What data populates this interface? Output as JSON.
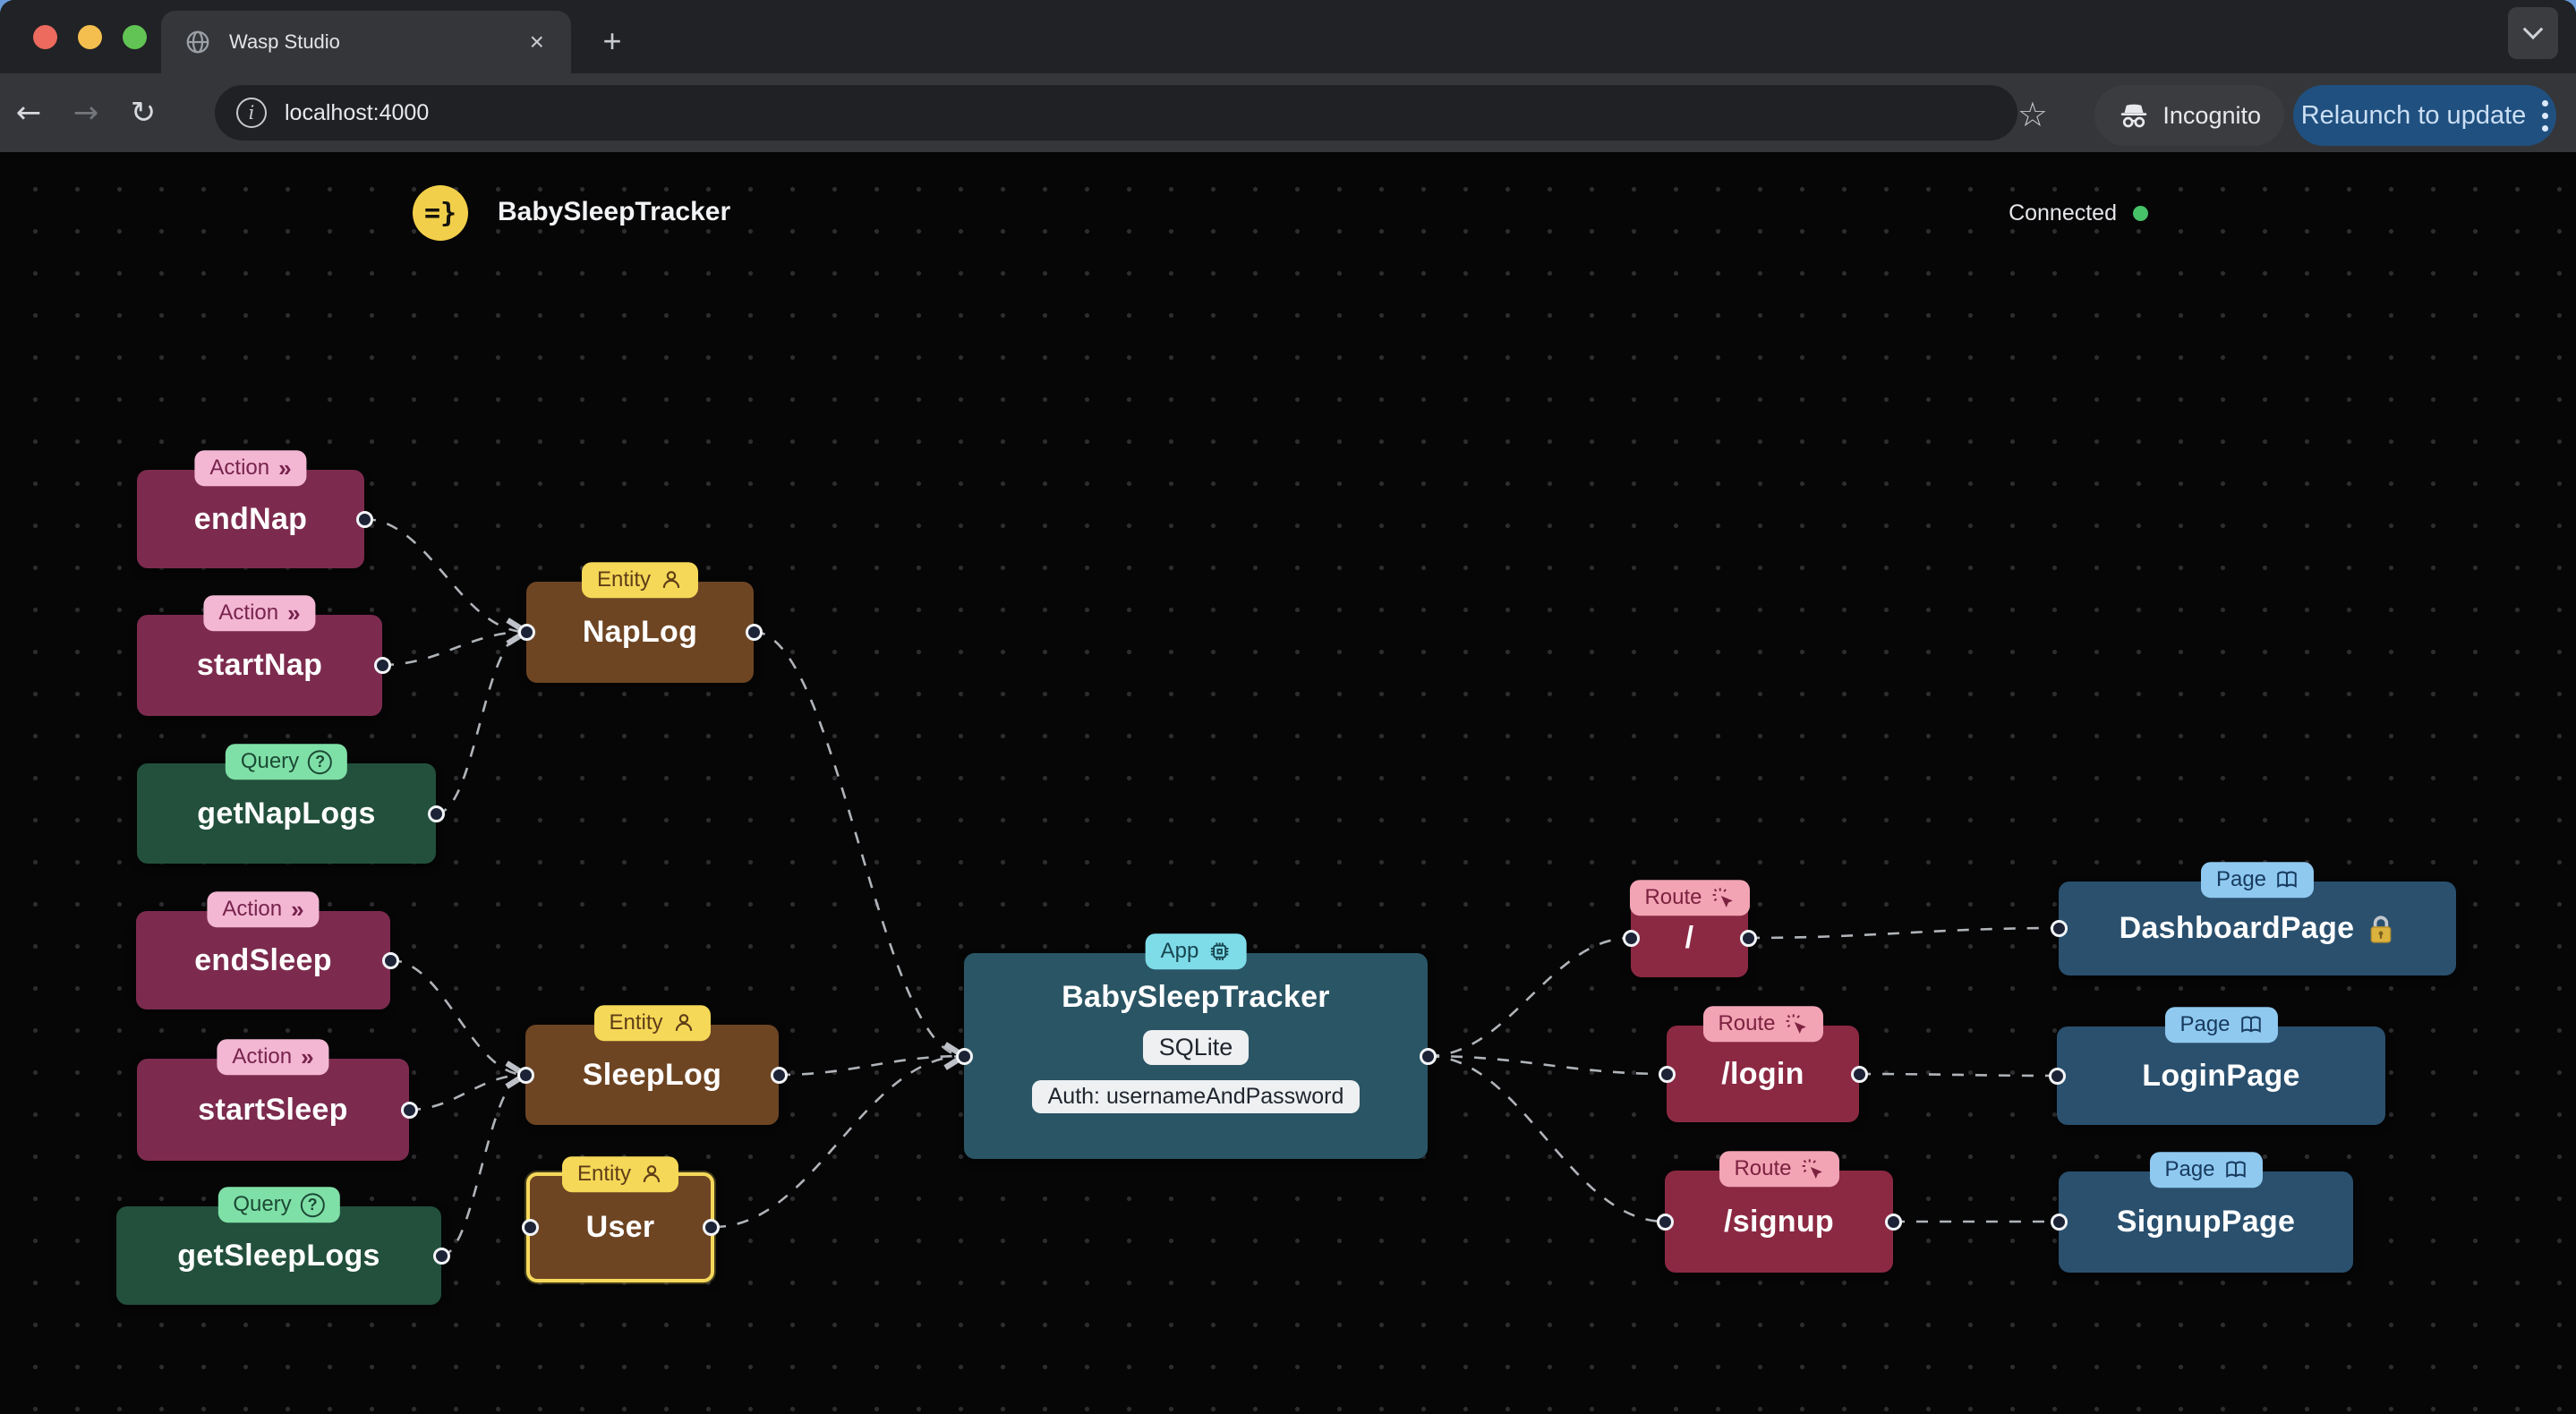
{
  "browser": {
    "tab_title": "Wasp Studio",
    "url": "localhost:4000",
    "incognito_label": "Incognito",
    "relaunch_label": "Relaunch to update"
  },
  "icons": {
    "back": "←",
    "forward": "→",
    "reload": "↻",
    "star": "☆",
    "new_tab": "+",
    "close_tab": "×",
    "info": "i",
    "wasp_logo": "=}",
    "action_chevrons": "»",
    "query_question": "?"
  },
  "header": {
    "app_title": "BabySleepTracker",
    "connection_status": "Connected",
    "connection_color": "#46c268"
  },
  "nodes": {
    "endNap": {
      "type": "action",
      "badge": "Action",
      "label": "endNap"
    },
    "startNap": {
      "type": "action",
      "badge": "Action",
      "label": "startNap"
    },
    "getNapLogs": {
      "type": "query",
      "badge": "Query",
      "label": "getNapLogs"
    },
    "endSleep": {
      "type": "action",
      "badge": "Action",
      "label": "endSleep"
    },
    "startSleep": {
      "type": "action",
      "badge": "Action",
      "label": "startSleep"
    },
    "getSleepLogs": {
      "type": "query",
      "badge": "Query",
      "label": "getSleepLogs"
    },
    "napLog": {
      "type": "entity",
      "badge": "Entity",
      "label": "NapLog"
    },
    "sleepLog": {
      "type": "entity",
      "badge": "Entity",
      "label": "SleepLog"
    },
    "user": {
      "type": "entity",
      "badge": "Entity",
      "label": "User",
      "selected": "true"
    },
    "app": {
      "type": "app",
      "badge": "App",
      "label": "BabySleepTracker",
      "database": "SQLite",
      "auth": "Auth: usernameAndPassword"
    },
    "routeRoot": {
      "type": "route",
      "badge": "Route",
      "label": "/"
    },
    "routeLogin": {
      "type": "route",
      "badge": "Route",
      "label": "/login"
    },
    "routeSignup": {
      "type": "route",
      "badge": "Route",
      "label": "/signup"
    },
    "dashboardPage": {
      "type": "page",
      "badge": "Page",
      "label": "DashboardPage",
      "auth_protected": "lock"
    },
    "loginPage": {
      "type": "page",
      "badge": "Page",
      "label": "LoginPage"
    },
    "signupPage": {
      "type": "page",
      "badge": "Page",
      "label": "SignupPage"
    }
  },
  "edges": [
    {
      "from": "endNap",
      "to": "napLog"
    },
    {
      "from": "startNap",
      "to": "napLog"
    },
    {
      "from": "getNapLogs",
      "to": "napLog"
    },
    {
      "from": "endSleep",
      "to": "sleepLog"
    },
    {
      "from": "startSleep",
      "to": "sleepLog"
    },
    {
      "from": "getSleepLogs",
      "to": "sleepLog"
    },
    {
      "from": "napLog",
      "to": "app"
    },
    {
      "from": "sleepLog",
      "to": "app"
    },
    {
      "from": "user",
      "to": "app"
    },
    {
      "from": "app",
      "to": "routeRoot"
    },
    {
      "from": "app",
      "to": "routeLogin"
    },
    {
      "from": "app",
      "to": "routeSignup"
    },
    {
      "from": "routeRoot",
      "to": "dashboardPage"
    },
    {
      "from": "routeLogin",
      "to": "loginPage"
    },
    {
      "from": "routeSignup",
      "to": "signupPage"
    }
  ],
  "colors": {
    "action_body": "#7c2b4e",
    "action_badge": "#f3b7d3",
    "query_body": "#22503c",
    "query_badge": "#7fe0a7",
    "entity_body": "#6e4523",
    "entity_badge": "#f5d858",
    "app_body": "#2a5565",
    "app_badge": "#7edce8",
    "route_body": "#8b2943",
    "route_badge": "#f2a4b4",
    "page_body": "#2a506e",
    "page_badge": "#8fc9f0",
    "edge": "#bfc3c9",
    "canvas": "#060607",
    "relaunch_button": "#20507f"
  }
}
